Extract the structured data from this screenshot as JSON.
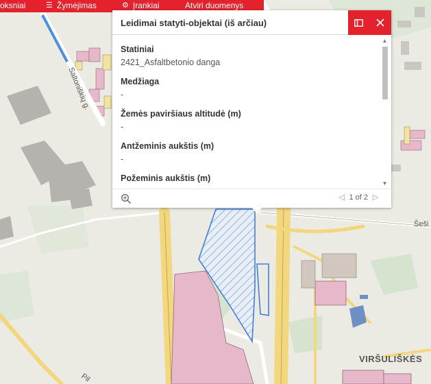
{
  "toolbar": {
    "items": [
      {
        "label": "oksniai",
        "icon": "none"
      },
      {
        "label": "Žymėjimas",
        "icon": "menu-icon"
      },
      {
        "label": "Įrankiai",
        "icon": "gear-icon"
      },
      {
        "label": "Atviri duomenys",
        "icon": "none"
      }
    ],
    "color": "#e3222d"
  },
  "popup": {
    "title": "Leidimai statyti-objektai (iš arčiau)",
    "fields": [
      {
        "label": "Statiniai",
        "value": "2421_Asfaltbetonio danga"
      },
      {
        "label": "Medžiaga",
        "value": "-"
      },
      {
        "label": "Žemės paviršiaus altitudė (m)",
        "value": "-"
      },
      {
        "label": "Antžeminis aukštis (m)",
        "value": "-"
      },
      {
        "label": "Požeminis aukštis (m)",
        "value": ""
      }
    ],
    "pager": {
      "text": "1 of 2"
    },
    "actions": [
      "dock-icon",
      "close-icon"
    ]
  },
  "map": {
    "labels": {
      "street_saltoniskiu": "Saltoniškių g.",
      "street_sesu": "Šeši",
      "district": "VIRŠULIŠKĖS",
      "street_pil": "Pil"
    }
  }
}
